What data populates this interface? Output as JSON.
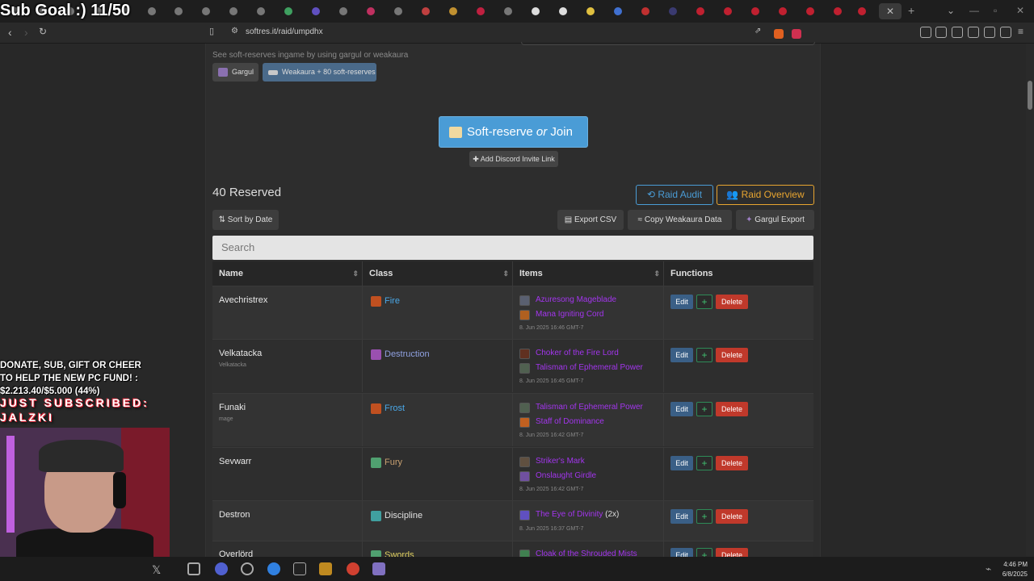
{
  "browser": {
    "url": "softres.it/raid/umpdhx",
    "active_tab_close": "✕",
    "new_tab": "+"
  },
  "overlay": {
    "sub_goal": "Sub Goal :) 11/50",
    "fund_line1": "DONATE, SUB, GIFT OR CHEER",
    "fund_line2": "TO HELP THE NEW PC FUND! :",
    "fund_line3": "$2.213.40/$5.000 (44%)",
    "subscribed_line1": "JUST SUBSCRIBED:",
    "subscribed_line2": "JALZKI"
  },
  "page": {
    "hint": "See soft-reserves ingame by using gargul or weakaura",
    "chip_gargul": "Gargul",
    "chip_weakaura": "Weakaura + 80 soft-reserves",
    "main_button_a": "Soft-reserve",
    "main_button_or": "or",
    "main_button_b": "Join",
    "discord_button": "Add Discord Invite Link",
    "reserved_count": "40 Reserved",
    "raid_audit": "Raid Audit",
    "raid_overview": "Raid Overview",
    "sort_by_date": "Sort by Date",
    "export_csv": "Export CSV",
    "copy_weakaura": "Copy Weakaura Data",
    "gargul_export": "Gargul Export",
    "search_placeholder": "Search"
  },
  "table": {
    "headers": {
      "name": "Name",
      "class": "Class",
      "items": "Items",
      "functions": "Functions"
    },
    "edit_label": "Edit",
    "plus_label": "+",
    "delete_label": "Delete",
    "rows": [
      {
        "name": "Avechristrex",
        "sub": "",
        "class": "Fire",
        "class_color": "#4aa8e8",
        "class_icon": "#c05020",
        "items": [
          {
            "name": "Azuresong Mageblade",
            "count": "",
            "icon": "#5a6070"
          },
          {
            "name": "Mana Igniting Cord",
            "count": "",
            "icon": "#b06020"
          }
        ],
        "date": "8. Jun 2025 16:46 GMT-7"
      },
      {
        "name": "Velkatacka",
        "sub": "Velkatacka",
        "class": "Destruction",
        "class_color": "#8fa0e0",
        "class_icon": "#9a50b0",
        "items": [
          {
            "name": "Choker of the Fire Lord",
            "count": "",
            "icon": "#603020"
          },
          {
            "name": "Talisman of Ephemeral Power",
            "count": "",
            "icon": "#506050"
          }
        ],
        "date": "8. Jun 2025 16:45 GMT-7"
      },
      {
        "name": "Funaki",
        "sub": "mage",
        "class": "Frost",
        "class_color": "#4aa8e8",
        "class_icon": "#c05020",
        "items": [
          {
            "name": "Talisman of Ephemeral Power",
            "count": "",
            "icon": "#506050"
          },
          {
            "name": "Staff of Dominance",
            "count": "",
            "icon": "#c06020"
          }
        ],
        "date": "8. Jun 2025 16:42 GMT-7"
      },
      {
        "name": "Sevwarr",
        "sub": "",
        "class": "Fury",
        "class_color": "#c8a070",
        "class_icon": "#50a070",
        "items": [
          {
            "name": "Striker's Mark",
            "count": "",
            "icon": "#605040"
          },
          {
            "name": "Onslaught Girdle",
            "count": "",
            "icon": "#7050a0"
          }
        ],
        "date": "8. Jun 2025 16:42 GMT-7"
      },
      {
        "name": "Destron",
        "sub": "",
        "class": "Discipline",
        "class_color": "#e0e0e0",
        "class_icon": "#40a0a0",
        "items": [
          {
            "name": "The Eye of Divinity",
            "count": "(2x)",
            "icon": "#6050c0"
          }
        ],
        "date": "8. Jun 2025 16:37 GMT-7"
      },
      {
        "name": "Overlörd",
        "sub": "",
        "class": "Swords",
        "class_color": "#e0d060",
        "class_icon": "#50a070",
        "items": [
          {
            "name": "Cloak of the Shrouded Mists",
            "count": "",
            "icon": "#408050"
          }
        ],
        "date": ""
      }
    ]
  },
  "taskbar": {
    "time": "4:46 PM",
    "date": "6/8/2025"
  },
  "colors": {
    "accent_blue": "#4a9cd6",
    "raid_overview_gold": "#e8a530",
    "epic_purple": "#a335ee",
    "delete_red": "#c0392b"
  }
}
